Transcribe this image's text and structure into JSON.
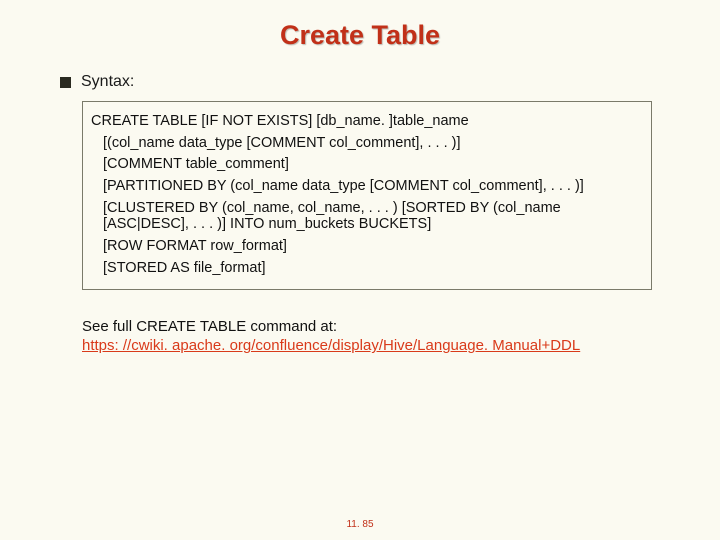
{
  "title": "Create Table",
  "syntax_label": "Syntax:",
  "code": {
    "l1": "CREATE TABLE [IF NOT EXISTS] [db_name. ]table_name",
    "l2": "[(col_name data_type [COMMENT col_comment], . . . )]",
    "l3": "[COMMENT table_comment]",
    "l4": "[PARTITIONED BY (col_name data_type [COMMENT col_comment], . . . )]",
    "l5": "[CLUSTERED BY (col_name, col_name, . . . ) [SORTED BY (col_name [ASC|DESC], . . . )] INTO num_buckets BUCKETS]",
    "l6": "[ROW FORMAT row_format]",
    "l7": "[STORED AS file_format]"
  },
  "see_text": "See full CREATE TABLE command at:",
  "see_link": "https: //cwiki. apache. org/confluence/display/Hive/Language. Manual+DDL",
  "page_number": "11. 85"
}
